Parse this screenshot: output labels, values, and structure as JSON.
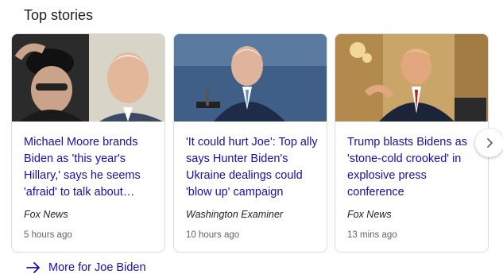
{
  "section": {
    "title": "Top stories"
  },
  "cards": [
    {
      "headline": "Michael Moore brands Biden as 'this year's Hillary,' says he seems 'afraid' to talk about…",
      "source": "Fox News",
      "time": "5 hours ago"
    },
    {
      "headline": "'It could hurt Joe': Top ally says Hunter Biden's Ukraine dealings could 'blow up' campaign",
      "source": "Washington Examiner",
      "time": "10 hours ago"
    },
    {
      "headline": "Trump blasts Bidens as 'stone-cold crooked' in explosive press conference",
      "source": "Fox News",
      "time": "13 mins ago"
    }
  ],
  "more": {
    "label": "More for Joe Biden"
  },
  "icons": {
    "next": "chevron-right-icon",
    "more": "arrow-right-icon"
  },
  "colors": {
    "link": "#1a0dab",
    "text": "#202124",
    "muted": "#5f6368",
    "border": "#dadce0"
  }
}
